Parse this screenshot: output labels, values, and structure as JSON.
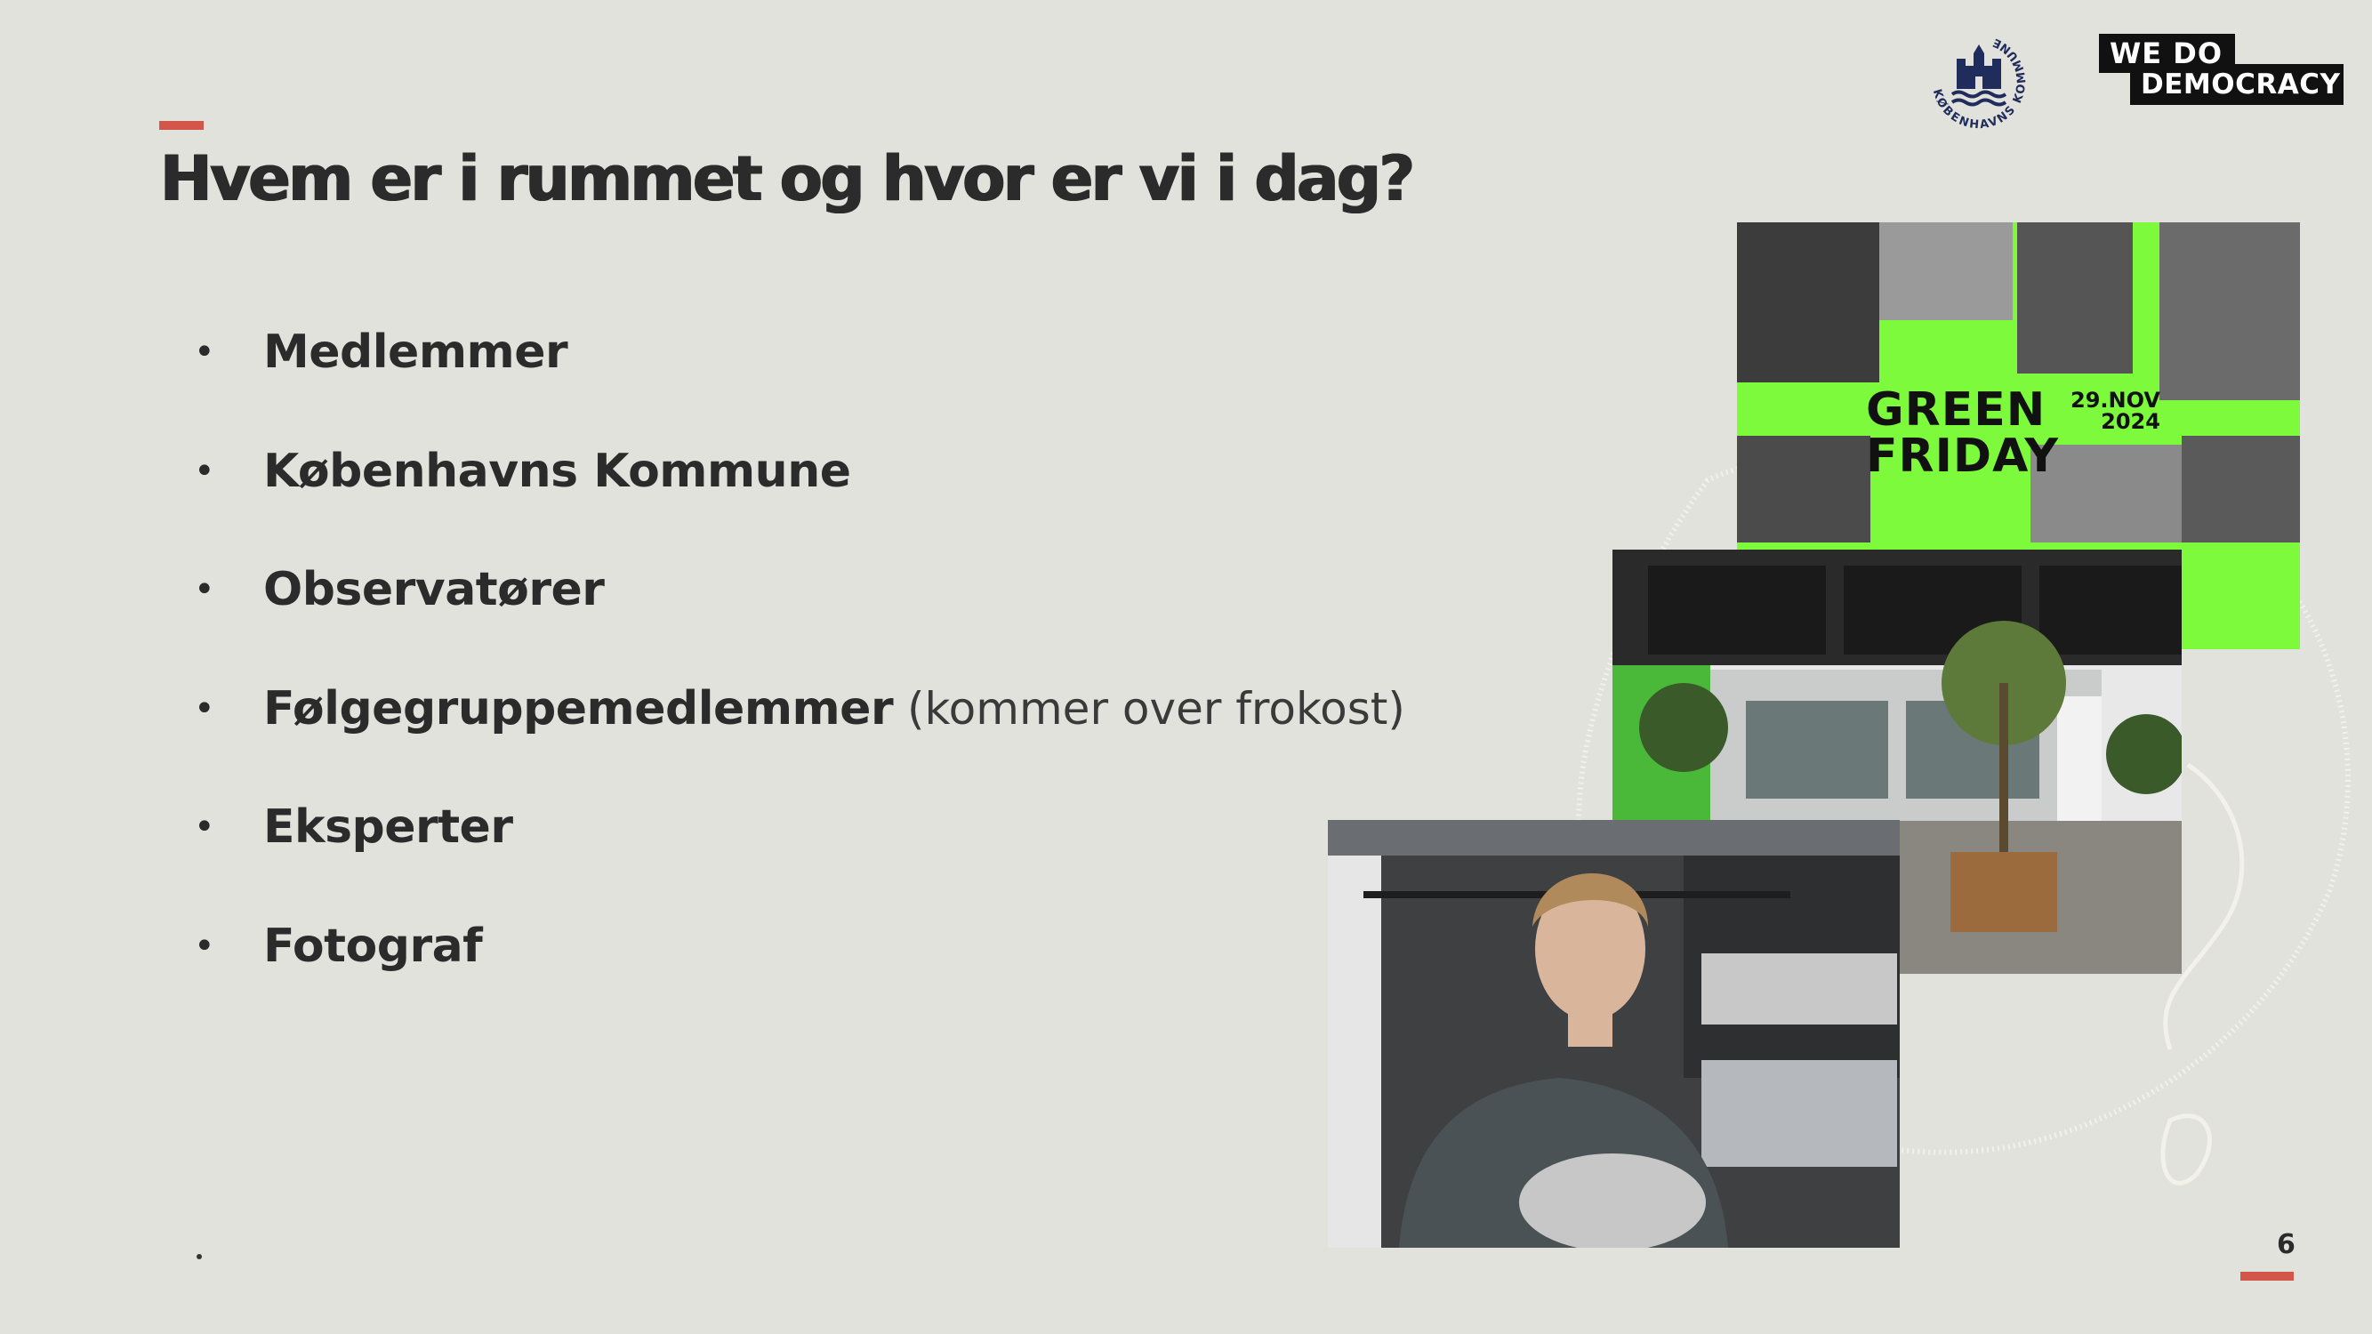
{
  "slide": {
    "title": "Hvem er i rummet og hvor er vi i dag?",
    "page_number": "6",
    "bullets": [
      {
        "bold": "Medlemmer",
        "light": ""
      },
      {
        "bold": "Københavns Kommune",
        "light": ""
      },
      {
        "bold": "Observatører",
        "light": ""
      },
      {
        "bold": "Følgegruppemedlemmer",
        "light": " (kommer over frokost)"
      },
      {
        "bold": "Eksperter",
        "light": ""
      },
      {
        "bold": "Fotograf",
        "light": ""
      }
    ],
    "bullet_char": "•"
  },
  "logos": {
    "kobenhavns_kommune_text": "KØBENHAVNS KOMMUNE",
    "wdd_line1": "WE  DO",
    "wdd_line2": "DEMOCRACY"
  },
  "poster": {
    "title_line1": "GREEN",
    "title_line2": "FRIDAY",
    "date_line1": "29.NOV",
    "date_line2": "2024"
  },
  "colors": {
    "background": "#e2e2dd",
    "accent": "#d2574a",
    "poster_green": "#7dfa3c",
    "text": "#2b2b2b"
  }
}
